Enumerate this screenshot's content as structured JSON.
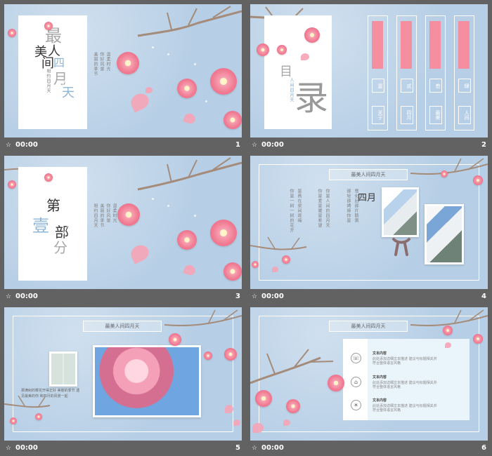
{
  "slides": [
    {
      "time": "00:00",
      "number": "1",
      "title_top": "最",
      "title_mid": "美",
      "title_person": "人",
      "title_between": "间",
      "title_month": "四",
      "title_yue": "月",
      "title_tian": "天",
      "vertical_text": [
        "相约四月天",
        "美丽的季节",
        "你好风景",
        "温柔时光"
      ]
    },
    {
      "time": "00:00",
      "number": "2",
      "title_small": "目",
      "title_big": "录",
      "subtitle": "人间四月天",
      "labels": [
        "壹",
        "贰",
        "叁",
        "肆"
      ],
      "outline_labels": [
        "关于",
        "四月",
        "最美",
        "人间"
      ]
    },
    {
      "time": "00:00",
      "number": "3",
      "title_first": "第",
      "title_one": "壹",
      "title_part": "部",
      "title_fen": "分",
      "vertical_text": [
        "相约四月天",
        "美丽的季节",
        "你好风景",
        "温柔时光"
      ]
    },
    {
      "time": "00:00",
      "number": "4",
      "heading": "最美人间四月天",
      "month": "四月",
      "columns": [
        "你是一树一树的花开",
        "是燕在梁间呢喃",
        "你是爱是暖是希望",
        "你是人间的四月天",
        "那轻那娉婷你是",
        "雪化后那片鹅黄"
      ]
    },
    {
      "time": "00:00",
      "number": "5",
      "heading": "最美人间四月天",
      "caption": "那满树的樱花开得正好 美丽的季节 遇见最美的你 和四月的风景一起"
    },
    {
      "time": "00:00",
      "number": "6",
      "heading": "最美人间四月天",
      "items": [
        {
          "title": "文本内容",
          "icon": "phone-icon",
          "body": "此处添加详细文本描述 建议与标题相关并符合整体语言风格"
        },
        {
          "title": "文本内容",
          "icon": "home-icon",
          "body": "此处添加详细文本描述 建议与标题相关并符合整体语言风格"
        },
        {
          "title": "文本内容",
          "icon": "bulb-icon",
          "body": "此处添加详细文本描述 建议与标题相关并符合整体语言风格"
        }
      ]
    }
  ],
  "play_icon": "play-icon",
  "colors": {
    "background": "#626262",
    "slide_background": "#b7cfe6",
    "accent_pink": "#f58f9f"
  }
}
